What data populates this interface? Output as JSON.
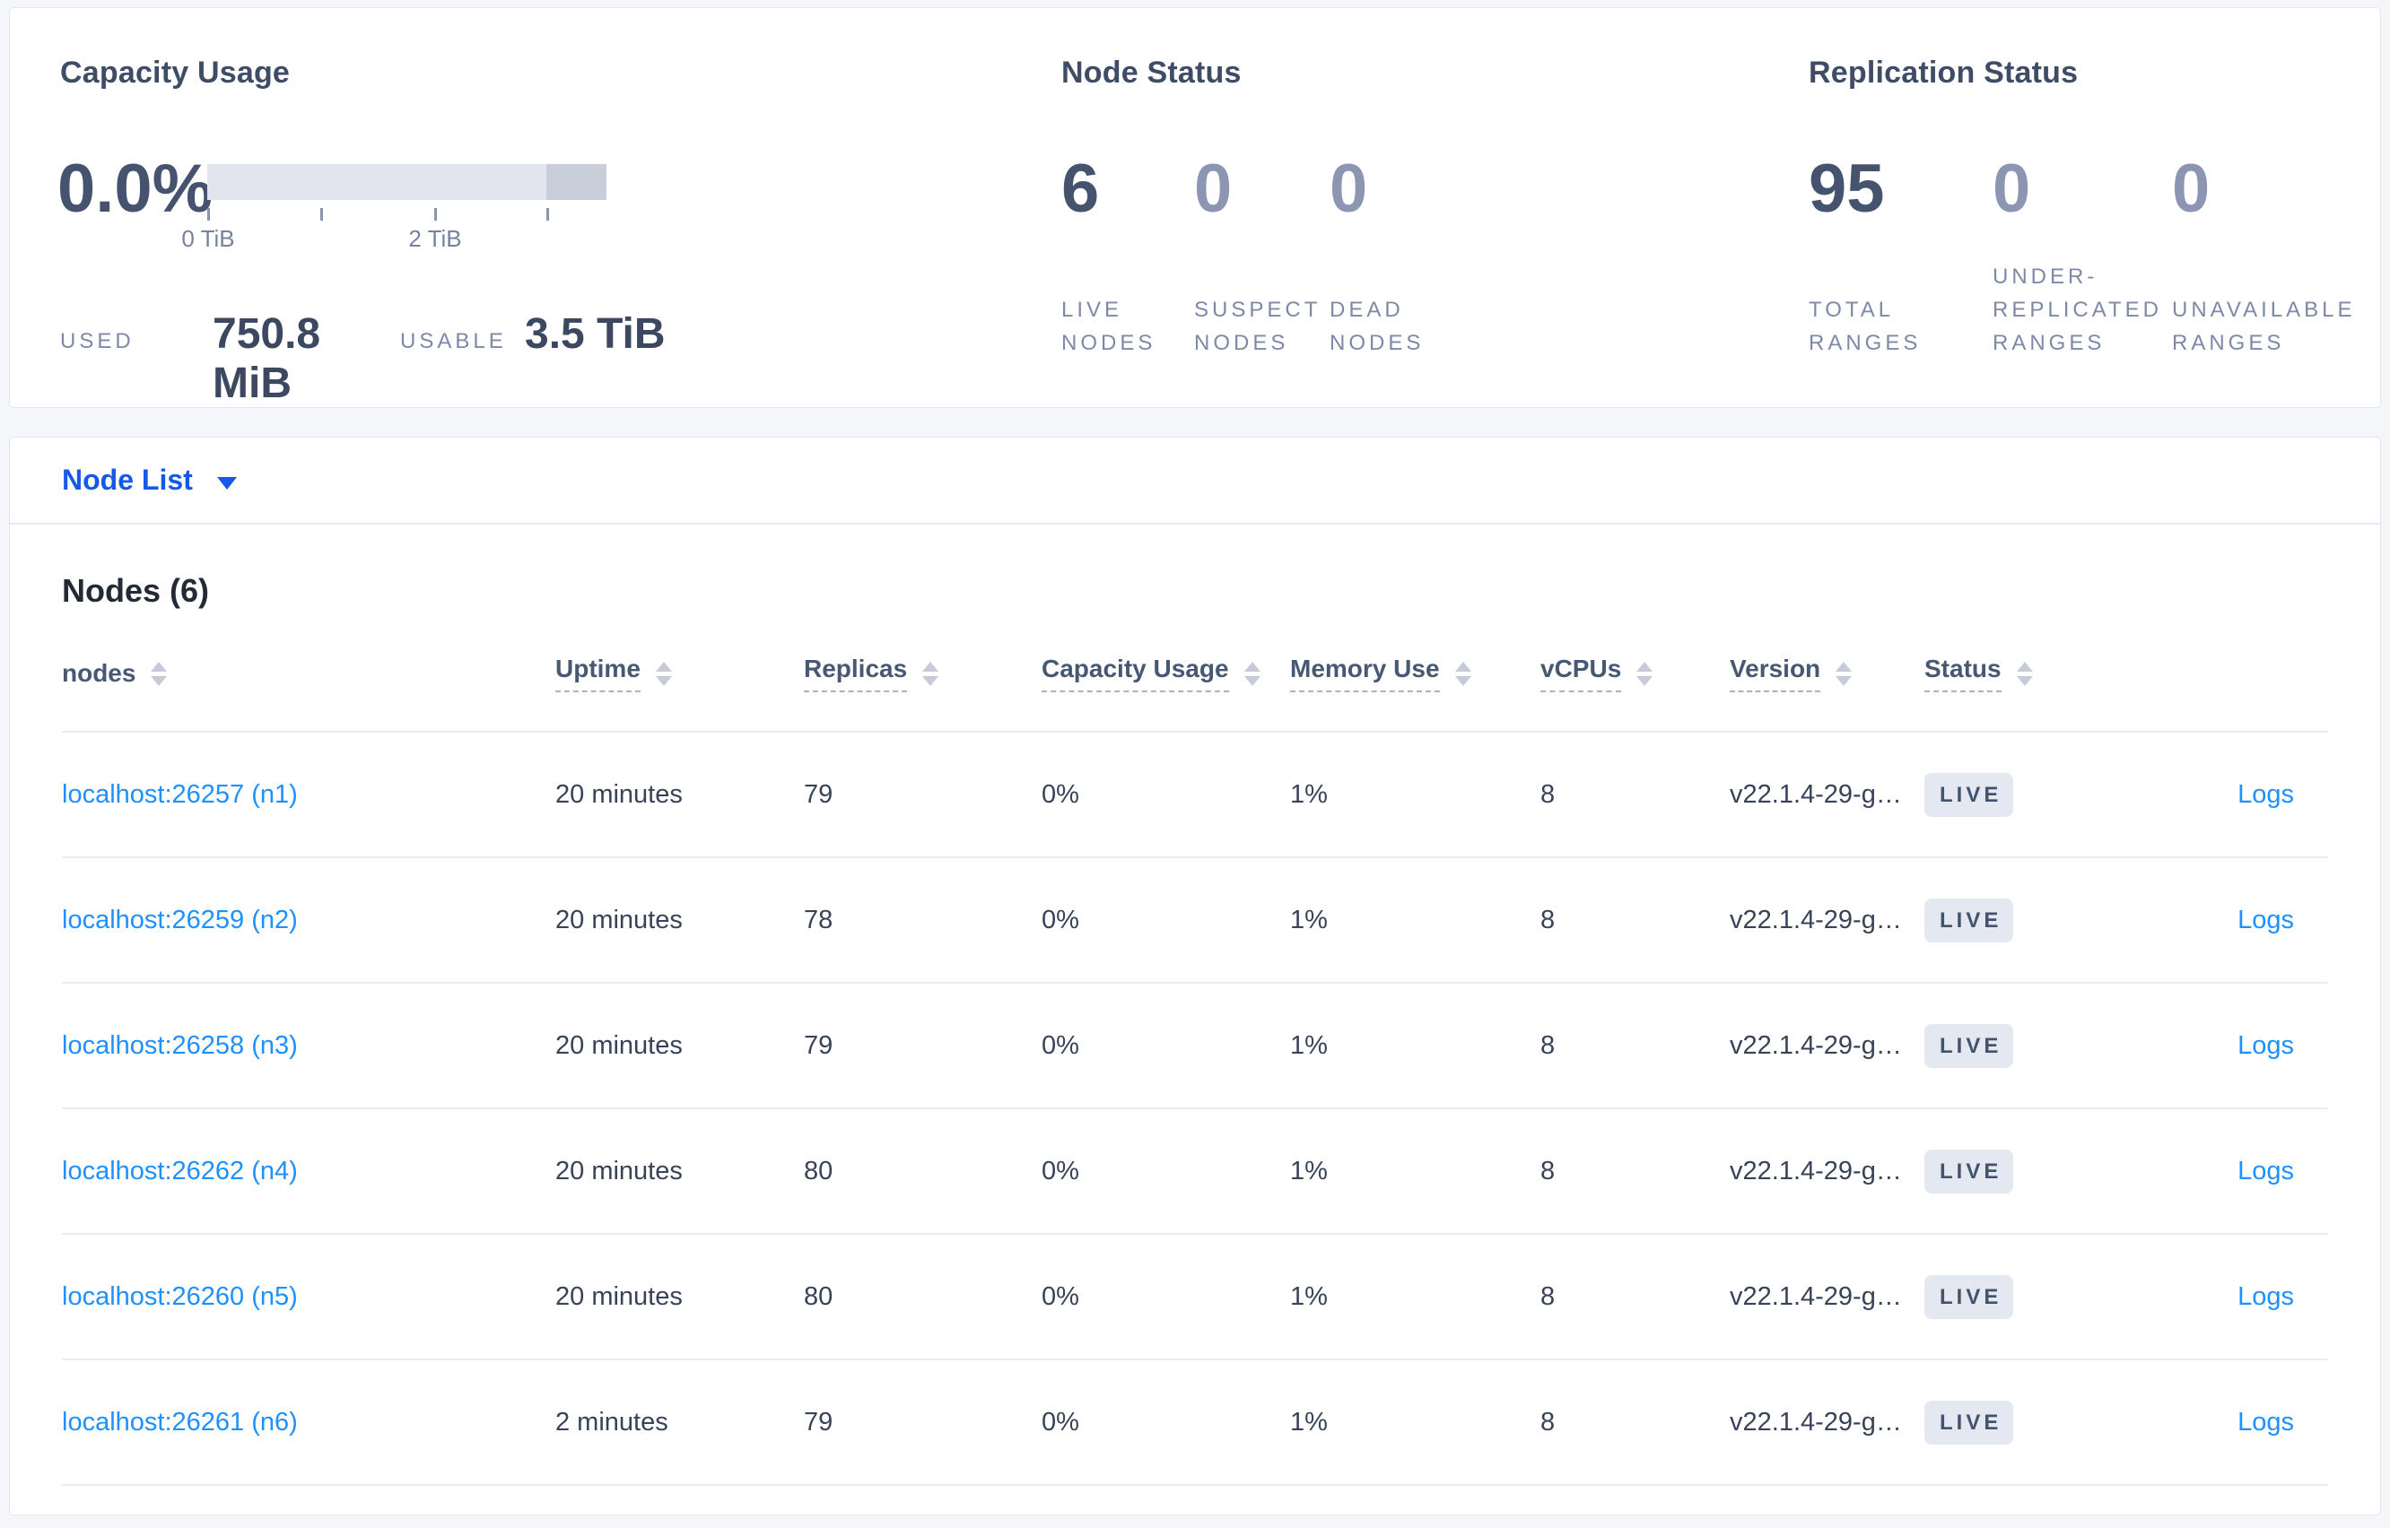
{
  "summary": {
    "capacity": {
      "title": "Capacity Usage",
      "percent": "0.0%",
      "tick_labels": [
        "0 TiB",
        "2 TiB"
      ],
      "used_label": "USED",
      "used_value": "750.8 MiB",
      "usable_label": "USABLE",
      "usable_value": "3.5 TiB"
    },
    "node_status": {
      "title": "Node Status",
      "stats": [
        {
          "value": "6",
          "label": "LIVE NODES"
        },
        {
          "value": "0",
          "label": "SUSPECT NODES"
        },
        {
          "value": "0",
          "label": "DEAD NODES"
        }
      ]
    },
    "replication": {
      "title": "Replication Status",
      "stats": [
        {
          "value": "95",
          "label": "TOTAL RANGES"
        },
        {
          "value": "0",
          "label": "UNDER-REPLICATED RANGES"
        },
        {
          "value": "0",
          "label": "UNAVAILABLE RANGES"
        }
      ]
    }
  },
  "node_list": {
    "dropdown_label": "Node List",
    "section_title": "Nodes (6)",
    "columns": [
      {
        "label": "nodes"
      },
      {
        "label": "Uptime"
      },
      {
        "label": "Replicas"
      },
      {
        "label": "Capacity Usage"
      },
      {
        "label": "Memory Use"
      },
      {
        "label": "vCPUs"
      },
      {
        "label": "Version"
      },
      {
        "label": "Status"
      }
    ],
    "logs_label": "Logs",
    "rows": [
      {
        "node": "localhost:26257 (n1)",
        "uptime": "20 minutes",
        "replicas": "79",
        "capacity": "0%",
        "memory": "1%",
        "vcpus": "8",
        "version": "v22.1.4-29-g…",
        "status": "LIVE"
      },
      {
        "node": "localhost:26259 (n2)",
        "uptime": "20 minutes",
        "replicas": "78",
        "capacity": "0%",
        "memory": "1%",
        "vcpus": "8",
        "version": "v22.1.4-29-g…",
        "status": "LIVE"
      },
      {
        "node": "localhost:26258 (n3)",
        "uptime": "20 minutes",
        "replicas": "79",
        "capacity": "0%",
        "memory": "1%",
        "vcpus": "8",
        "version": "v22.1.4-29-g…",
        "status": "LIVE"
      },
      {
        "node": "localhost:26262 (n4)",
        "uptime": "20 minutes",
        "replicas": "80",
        "capacity": "0%",
        "memory": "1%",
        "vcpus": "8",
        "version": "v22.1.4-29-g…",
        "status": "LIVE"
      },
      {
        "node": "localhost:26260 (n5)",
        "uptime": "20 minutes",
        "replicas": "80",
        "capacity": "0%",
        "memory": "1%",
        "vcpus": "8",
        "version": "v22.1.4-29-g…",
        "status": "LIVE"
      },
      {
        "node": "localhost:26261 (n6)",
        "uptime": "2 minutes",
        "replicas": "79",
        "capacity": "0%",
        "memory": "1%",
        "vcpus": "8",
        "version": "v22.1.4-29-g…",
        "status": "LIVE"
      }
    ]
  },
  "colors": {
    "page_background": "#f4f6fa",
    "card_background": "#ffffff",
    "dropdown_blue": "#1659e9",
    "link_blue": "#1e90ff",
    "stat_dark": "#45536e",
    "stat_muted": "#8c96b2",
    "label_muted": "#7d89a6",
    "badge_background": "#e4e8f0",
    "bar_track": "#e3e5ee",
    "bar_segment": "#c9cedb"
  }
}
